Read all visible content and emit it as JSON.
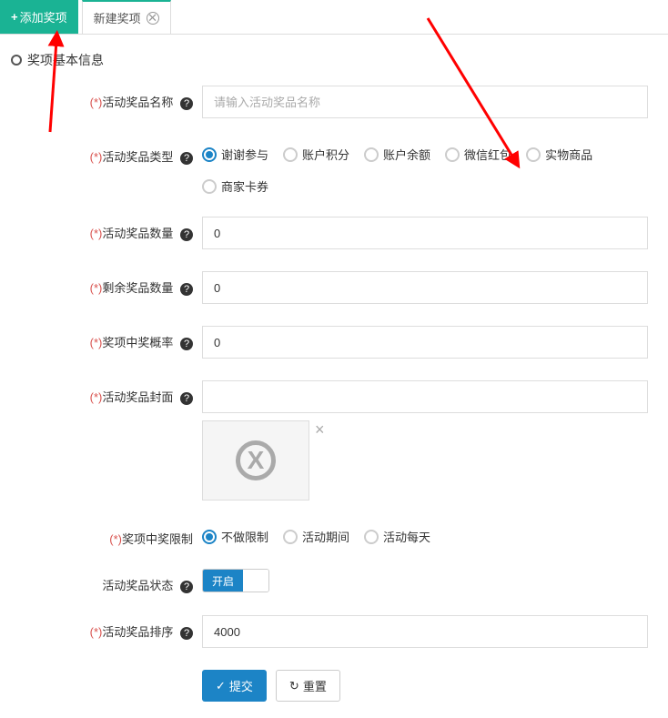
{
  "tabs": {
    "add_label": "添加奖项",
    "new_label": "新建奖项"
  },
  "section": {
    "title": "奖项基本信息"
  },
  "form": {
    "name": {
      "label": "活动奖品名称",
      "placeholder": "请输入活动奖品名称",
      "value": ""
    },
    "type": {
      "label": "活动奖品类型",
      "options": [
        "谢谢参与",
        "账户积分",
        "账户余额",
        "微信红包",
        "实物商品",
        "商家卡券"
      ],
      "selected": 0
    },
    "quantity": {
      "label": "活动奖品数量",
      "value": "0"
    },
    "remaining": {
      "label": "剩余奖品数量",
      "value": "0"
    },
    "probability": {
      "label": "奖项中奖概率",
      "value": "0"
    },
    "cover": {
      "label": "活动奖品封面"
    },
    "limit": {
      "label": "奖项中奖限制",
      "options": [
        "不做限制",
        "活动期间",
        "活动每天"
      ],
      "selected": 0
    },
    "status": {
      "label": "活动奖品状态",
      "value": "开启"
    },
    "sort": {
      "label": "活动奖品排序",
      "value": "4000"
    }
  },
  "buttons": {
    "submit": "提交",
    "reset": "重置"
  }
}
